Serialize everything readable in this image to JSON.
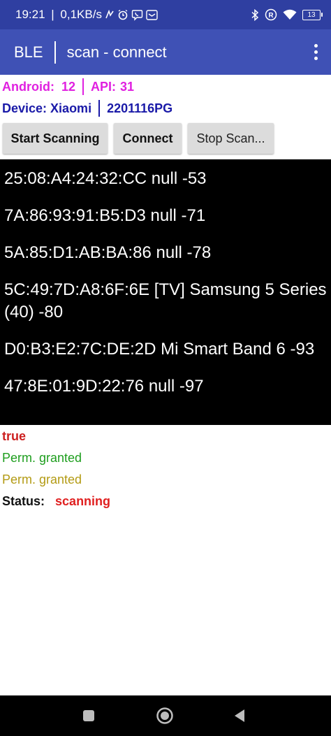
{
  "status_bar": {
    "time": "19:21",
    "speed": "0,1KB/s",
    "battery": "13",
    "icons": [
      "nfc-icon",
      "alarm-icon",
      "viber-icon",
      "mail-icon",
      "bluetooth-icon",
      "registered-icon",
      "wifi-icon",
      "battery-icon"
    ]
  },
  "app_bar": {
    "title_left": "BLE",
    "title_right": "scan - connect",
    "overflow_icon": "more-vert-icon"
  },
  "info": {
    "android_label": "Android:",
    "android_version": "12",
    "api_label": "API:",
    "api_level": "31",
    "device_label": "Device:",
    "device_brand": "Xiaomi",
    "device_model": "2201116PG"
  },
  "buttons": {
    "start_scanning": "Start Scanning",
    "connect": "Connect",
    "stop_scan": "Stop Scan..."
  },
  "devices": [
    "25:08:A4:24:32:CC null -53",
    "7A:86:93:91:B5:D3 null -71",
    "5A:85:D1:AB:BA:86 null -78",
    "5C:49:7D:A8:6F:6E [TV] Samsung 5 Series (40) -80",
    "D0:B3:E2:7C:DE:2D Mi Smart Band 6 -93",
    "47:8E:01:9D:22:76 null -97"
  ],
  "status_lines": {
    "true_text": "true",
    "perm_granted_1": "Perm. granted",
    "perm_granted_2": "Perm. granted",
    "status_label": "Status:",
    "status_value": "scanning"
  },
  "colors": {
    "status_bar": "#2f3fa1",
    "app_bar": "#3f51b5",
    "android_info": "#e020e0",
    "device_info": "#1a1aa8",
    "true_text": "#cc1f1f",
    "perm_1": "#1e9e1e",
    "perm_2": "#b39b14",
    "status_value": "#e02020"
  }
}
